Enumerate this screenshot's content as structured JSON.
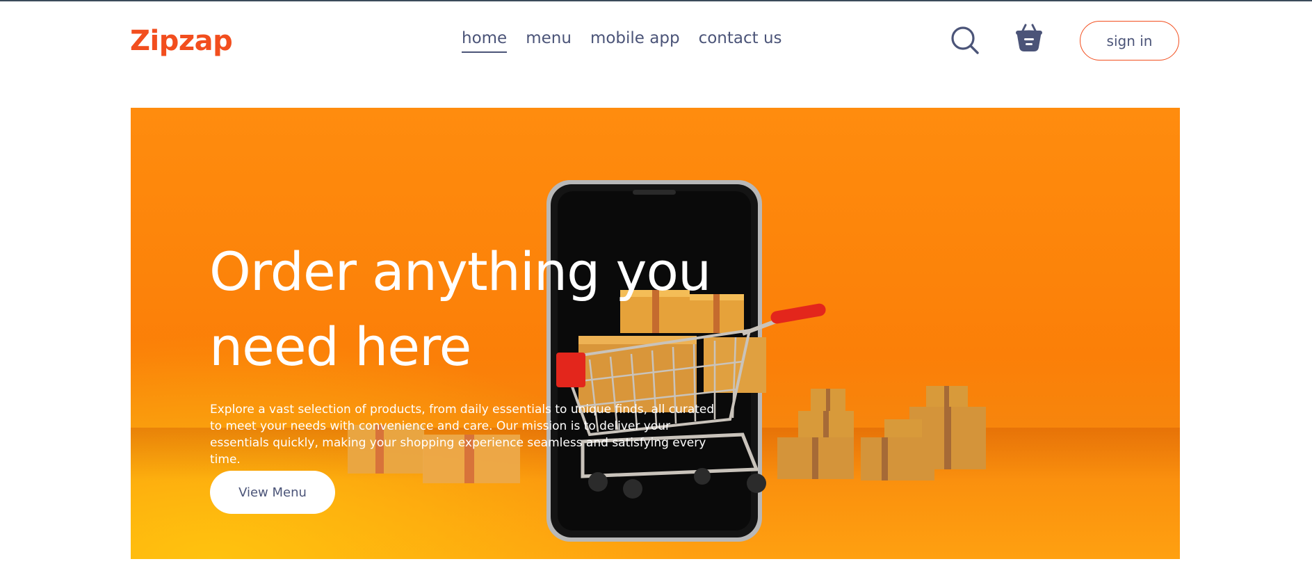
{
  "brand": {
    "name": "Zipzap",
    "color": "#f24e1e"
  },
  "nav": {
    "items": [
      {
        "label": "home",
        "active": true
      },
      {
        "label": "menu",
        "active": false
      },
      {
        "label": "mobile app",
        "active": false
      },
      {
        "label": "contact us",
        "active": false
      }
    ]
  },
  "header_actions": {
    "search_icon": "search-icon",
    "basket_icon": "basket-icon",
    "sign_in_label": "sign in"
  },
  "hero": {
    "title": "Order anything you need here",
    "description": "Explore a vast selection of products, from daily essentials to unique finds, all curated to meet your needs with convenience and care. Our mission is to deliver your essentials quickly, making your shopping experience seamless and satisfying every time.",
    "cta_label": "View Menu",
    "image": "smartphone-with-shopping-cart-and-gift-boxes",
    "background_color": "#fb7f08"
  },
  "colors": {
    "accent": "#f24e1e",
    "text": "#4b5478",
    "hero_orange": "#fb7f08"
  }
}
